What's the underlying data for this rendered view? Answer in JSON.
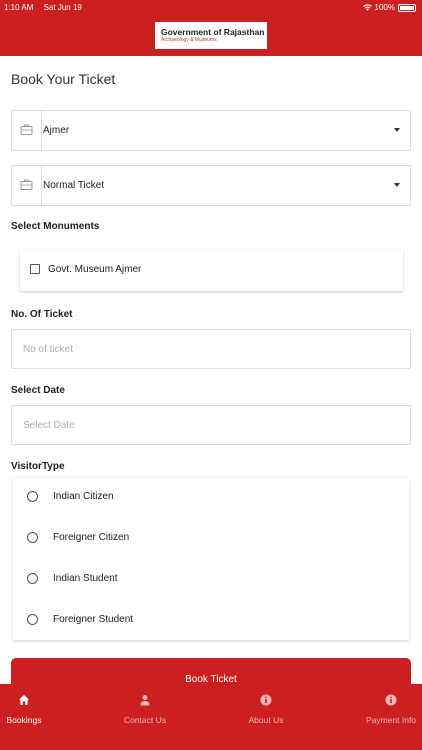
{
  "status_bar": {
    "time": "1:10 AM",
    "date": "Sat Jun 19",
    "battery": "100%"
  },
  "header": {
    "logo_title": "Government of Rajasthan",
    "logo_subtitle": "Archaeology & Museums"
  },
  "page_title": "Book Your Ticket",
  "location_select": {
    "value": "Ajmer"
  },
  "ticket_type_select": {
    "value": "Normal Ticket"
  },
  "monuments": {
    "label": "Select Monuments",
    "items": [
      {
        "label": "Govt. Museum Ajmer",
        "checked": false
      }
    ]
  },
  "ticket_count": {
    "label": "No. Of Ticket",
    "placeholder": "No of ticket",
    "value": ""
  },
  "date_field": {
    "label": "Select Date",
    "placeholder": "Select Date",
    "value": ""
  },
  "visitor_type": {
    "label": "VisitorType",
    "options": [
      {
        "label": "Indian Citizen",
        "selected": false
      },
      {
        "label": "Foreigner Citizen",
        "selected": false
      },
      {
        "label": "Indian Student",
        "selected": false
      },
      {
        "label": "Foreigner Student",
        "selected": false
      }
    ]
  },
  "book_button": {
    "label": "Book Ticket"
  },
  "tabs": [
    {
      "label": "Bookings",
      "icon": "home-icon",
      "active": true
    },
    {
      "label": "Contact Us",
      "icon": "person-icon",
      "active": false
    },
    {
      "label": "About Us",
      "icon": "info-icon",
      "active": false
    },
    {
      "label": "Payment Info",
      "icon": "info-icon",
      "active": false
    }
  ],
  "colors": {
    "brand": "#cc1f1f",
    "inactive_tab": "#f2b8b8"
  }
}
